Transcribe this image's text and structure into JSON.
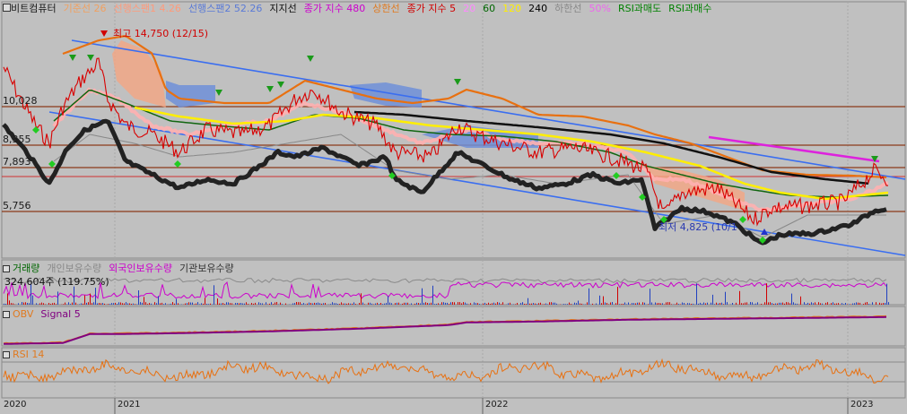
{
  "legend": [
    {
      "text": "비트컴퓨터",
      "color": "#1a1a1a"
    },
    {
      "text": "기준선 26",
      "color": "#f0a060"
    },
    {
      "text": "선행스팬1 4.26",
      "color": "#ff9a7a"
    },
    {
      "text": "선행스팬2 52.26",
      "color": "#5a7ad6"
    },
    {
      "text": "지지선",
      "color": "#111111"
    },
    {
      "text": "종가 지수 480",
      "color": "#cc00cc"
    },
    {
      "text": "상한선",
      "color": "#e07a20"
    },
    {
      "text": "종가 지수 5",
      "color": "#d00000"
    },
    {
      "text": "20",
      "color": "#ff88ff"
    },
    {
      "text": "60",
      "color": "#006600"
    },
    {
      "text": "120",
      "color": "#ffee00"
    },
    {
      "text": "240",
      "color": "#000000"
    },
    {
      "text": "하한선",
      "color": "#888888"
    },
    {
      "text": "50%",
      "color": "#ee66ee"
    },
    {
      "text": "RSI과매도",
      "color": "#008000"
    },
    {
      "text": "RSI과매수",
      "color": "#008000"
    }
  ],
  "price_labels": [
    "10,028",
    "8,355",
    "7,893",
    "5,756"
  ],
  "annotations": {
    "high": "최고 14,750 (12/15)",
    "low": "최저 4,825 (10/1"
  },
  "volume_panel": {
    "legend": [
      {
        "text": "거래량",
        "color": "#006600"
      },
      {
        "text": "개인보유수량",
        "color": "#888888"
      },
      {
        "text": "외국인보유수량",
        "color": "#cc00cc"
      },
      {
        "text": "기관보유수량",
        "color": "#333333"
      }
    ],
    "value": "324,604주 (119.75%)"
  },
  "obv_panel": {
    "legend": [
      {
        "text": "OBV",
        "color": "#e07a20"
      },
      {
        "text": "Signal 5",
        "color": "#800080"
      }
    ]
  },
  "rsi_panel": {
    "legend": [
      {
        "text": "RSI 14",
        "color": "#e07a20"
      }
    ]
  },
  "x_axis": [
    "2020",
    "2021",
    "2022",
    "2023"
  ],
  "chart_data": {
    "type": "line",
    "title": "비트컴퓨터",
    "x": [
      "2020",
      "2021",
      "2022",
      "2023"
    ],
    "series": [
      {
        "name": "종가 지수 5",
        "values": [
          9800,
          12500,
          13600,
          10200,
          9000,
          8200,
          9500,
          8700,
          9900,
          9600,
          10200,
          8200,
          8300,
          9800,
          8400,
          8000,
          8500,
          7700,
          6500,
          6100,
          6300,
          6800,
          7300
        ]
      },
      {
        "name": "240",
        "values": [
          9600,
          9400,
          9200,
          8900,
          8500,
          8000,
          7400,
          7100,
          7000
        ]
      }
    ],
    "ylim": [
      4000,
      16000
    ],
    "price_lines": [
      10028,
      8355,
      7893,
      5756
    ],
    "high": 14750,
    "low": 4825
  }
}
